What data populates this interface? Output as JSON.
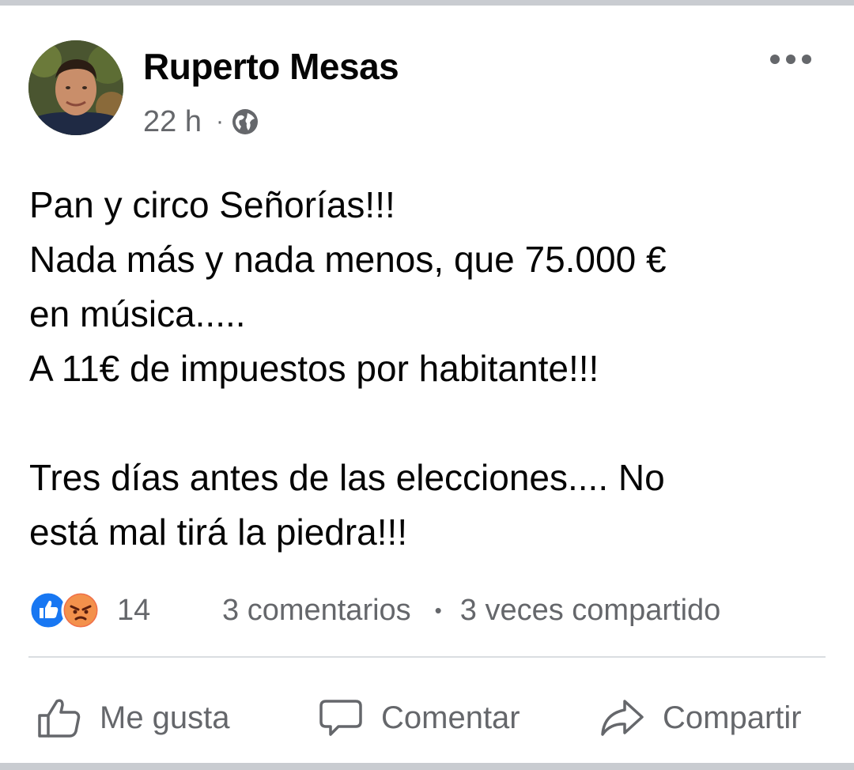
{
  "post": {
    "author_name": "Ruperto Mesas",
    "timestamp": "22 h",
    "separator": "·",
    "privacy_icon": "globe-icon",
    "more_icon": "more-options-icon",
    "lines": [
      "Pan y circo Señorías!!!",
      "Nada más y nada menos, que 75.000 €",
      "en música.....",
      "A 11€ de impuestos por habitante!!!",
      "",
      "Tres días antes de las elecciones.... No",
      "está mal tirá la piedra!!!"
    ]
  },
  "reactions": {
    "icons": [
      "like-reaction-icon",
      "angry-reaction-icon"
    ],
    "count": "14",
    "comments": "3 comentarios",
    "bullet": "•",
    "shares": "3 veces compartido"
  },
  "actions": {
    "like": "Me gusta",
    "comment": "Comentar",
    "share": "Compartir"
  },
  "colors": {
    "text": "#050505",
    "secondary": "#65676b",
    "like_blue": "#1877f2",
    "angry_orange": "#f0704a",
    "divider": "#dadde1",
    "page_border": "#c9ccd1"
  }
}
